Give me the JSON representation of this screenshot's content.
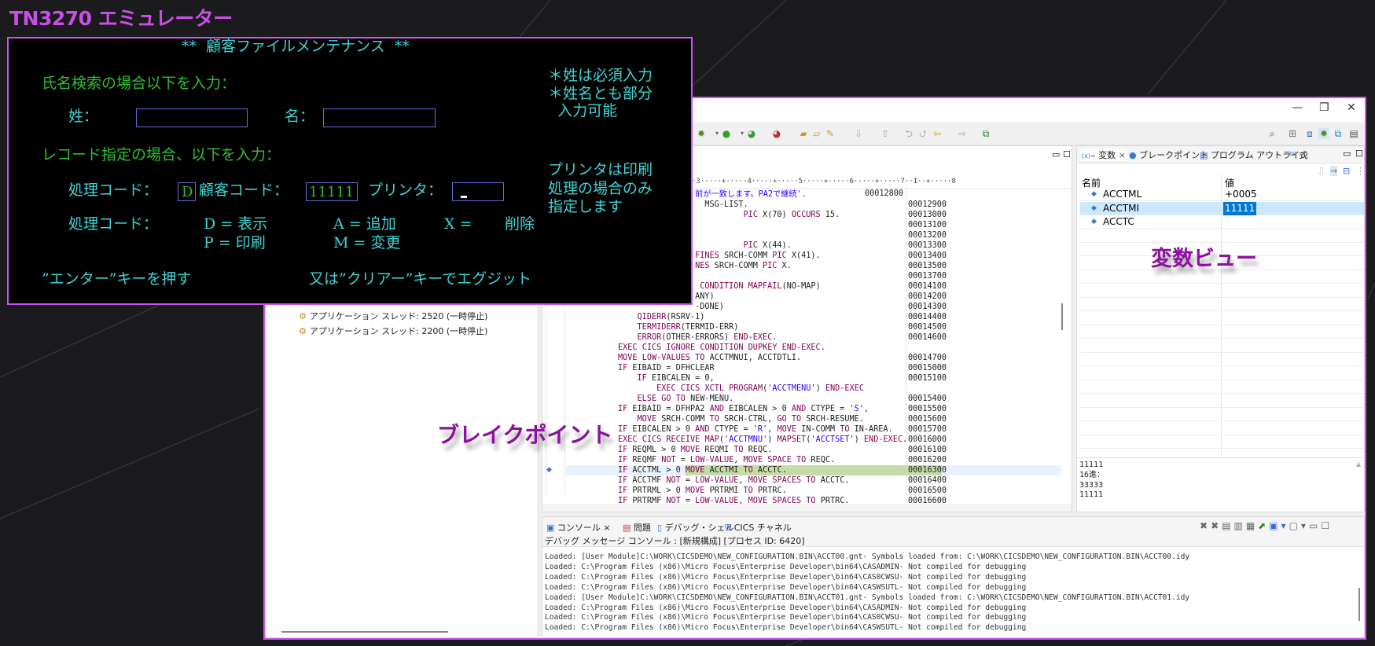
{
  "page_title": "TN3270 エミュレーター",
  "colors": {
    "accent": "#cc55ee",
    "emulator_cyan": "#3fd4d4",
    "emulator_green": "#2fc02f",
    "annotation": "#8e0fa0",
    "breakpoint_highlight": "#c5dba8"
  },
  "emulator": {
    "title": "**  顧客ファイルメンテナンス  **",
    "name_search_label": "氏名検索の場合以下を入力：",
    "last_name_label": "姓：",
    "first_name_label": "名：",
    "last_name_value": "",
    "first_name_value": "",
    "notes1": [
      "＊姓は必須入力",
      "＊姓名とも部分",
      "  入力可能"
    ],
    "record_label": "レコード指定の場合、以下を入力：",
    "proc_code_label": "処理コード：",
    "proc_code_value": "D",
    "cust_code_label": "顧客コード：",
    "cust_code_value": "11111",
    "printer_label": "プリンタ：",
    "notes2": [
      "プリンタは印刷",
      "処理の場合のみ",
      "指定します"
    ],
    "codes_label": "処理コード：",
    "codes": [
      "D = 表示",
      "A = 追加",
      "X =",
      "削除",
      "P = 印刷",
      "M = 変更"
    ],
    "footer_left": "”エンター”キーを押す",
    "footer_right": "又は”クリアー”キーでエグジット"
  },
  "ide": {
    "window_controls": [
      "—",
      "❐",
      "✕"
    ],
    "threads": [
      "アプリケーション スレッド: 2520 (一時停止)",
      "アプリケーション スレッド: 2200 (一時停止)"
    ],
    "editor": {
      "ruler": "·3·····+·····4·····+·····5·····+·····6·····+·····7··I··+·····8",
      "inline_seq": "00012800",
      "lines": [
        "                前が一致します。PA2で継続'.",
        "                  MSG-LIST.",
        "                          PIC X(70) OCCURS 15.",
        "",
        "",
        "                          PIC X(44).",
        "                FINES SRCH-COMM PIC X(41).",
        "                NES SRCH-COMM PIC X.",
        "",
        "                 CONDITION MAPFAIL(NO-MAP)",
        "                ANY)",
        "                -DONE)",
        "    QIDERR(RSRV-1)",
        "    TERMIDERR(TERMID-ERR)",
        "    ERROR(OTHER-ERRORS) END-EXEC.",
        "EXEC CICS IGNORE CONDITION DUPKEY END-EXEC.",
        "MOVE LOW-VALUES TO ACCTMNUI, ACCTDTLI.",
        "IF EIBAID = DFHCLEAR",
        "    IF EIBCALEN = 0,",
        "        EXEC CICS XCTL PROGRAM('ACCTMENU') END-EXEC",
        "    ELSE GO TO NEW-MENU.",
        "IF EIBAID = DFHPA2 AND EIBCALEN > 0 AND CTYPE = 'S',",
        "    MOVE SRCH-COMM TO SRCH-CTRL, GO TO SRCH-RESUME.",
        "IF EIBCALEN > 0 AND CTYPE = 'R', MOVE IN-COMM TO IN-AREA.",
        "EXEC CICS RECEIVE MAP('ACCTMNU') MAPSET('ACCTSET') END-EXEC.",
        "IF REQML > 0 MOVE REQMI TO REQC.",
        "IF REQMF NOT = LOW-VALUE, MOVE SPACE TO REQC.",
        "IF ACCTML > 0 MOVE ACCTMI TO ACCTC.",
        "IF ACCTMF NOT = LOW-VALUE, MOVE SPACES TO ACCTC.",
        "IF PRTRML > 0 MOVE PRTRMI TO PRTRC.",
        "IF PRTRMF NOT = LOW-VALUE, MOVE SPACES TO PRTRC."
      ],
      "line_numbers": [
        "",
        "00012900",
        "00013000",
        "00013100",
        "00013200",
        "00013300",
        "00013400",
        "00013500",
        "00013700",
        "00014100",
        "00014200",
        "00014300",
        "00014400",
        "00014500",
        "00014600",
        "",
        "00014700",
        "00015000",
        "00015100",
        "",
        "00015400",
        "00015500",
        "00015600",
        "00015700",
        "00016000",
        "00016100",
        "00016200",
        "00016300",
        "00016400",
        "00016500",
        "00016600"
      ],
      "current_line_index": 27
    },
    "variables": {
      "tabs": [
        "変数",
        "ブレークポイント",
        "プログラム アウトライン",
        "式"
      ],
      "col_name": "名前",
      "col_value": "値",
      "rows": [
        {
          "name": "ACCTML",
          "value": "+0005"
        },
        {
          "name": "ACCTMI",
          "value": "11111",
          "selected": true
        },
        {
          "name": "ACCTC",
          "value": ""
        }
      ],
      "detail": [
        "11111",
        "16進：",
        "33333",
        "11111"
      ]
    },
    "console": {
      "tabs": [
        "コンソール",
        "問題",
        "デバッグ・シェル",
        "CICS チャネル"
      ],
      "header": "デバッグ メッセージ コンソール : [新規構成] [プロセス ID: 6420]",
      "lines": [
        "Loaded: [User Module]C:\\WORK\\CICSDEMO\\NEW_CONFIGURATION.BIN\\ACCT00.gnt- Symbols loaded from: C:\\WORK\\CICSDEMO\\NEW_CONFIGURATION.BIN\\ACCT00.idy",
        "Loaded: C:\\Program Files (x86)\\Micro Focus\\Enterprise Developer\\bin64\\CASADMIN- Not compiled for debugging",
        "Loaded: C:\\Program Files (x86)\\Micro Focus\\Enterprise Developer\\bin64\\CAS0CWSU- Not compiled for debugging",
        "Loaded: C:\\Program Files (x86)\\Micro Focus\\Enterprise Developer\\bin64\\CASWSUTL- Not compiled for debugging",
        "Loaded: [User Module]C:\\WORK\\CICSDEMO\\NEW_CONFIGURATION.BIN\\ACCT01.gnt- Symbols loaded from: C:\\WORK\\CICSDEMO\\NEW_CONFIGURATION.BIN\\ACCT01.idy",
        "Loaded: C:\\Program Files (x86)\\Micro Focus\\Enterprise Developer\\bin64\\CASADMIN- Not compiled for debugging",
        "Loaded: C:\\Program Files (x86)\\Micro Focus\\Enterprise Developer\\bin64\\CAS0CWSU- Not compiled for debugging",
        "Loaded: C:\\Program Files (x86)\\Micro Focus\\Enterprise Developer\\bin64\\CASWSUTL- Not compiled for debugging"
      ]
    }
  },
  "annotations": {
    "breakpoint": "ブレイクポイント",
    "variables_view": "変数ビュー"
  }
}
